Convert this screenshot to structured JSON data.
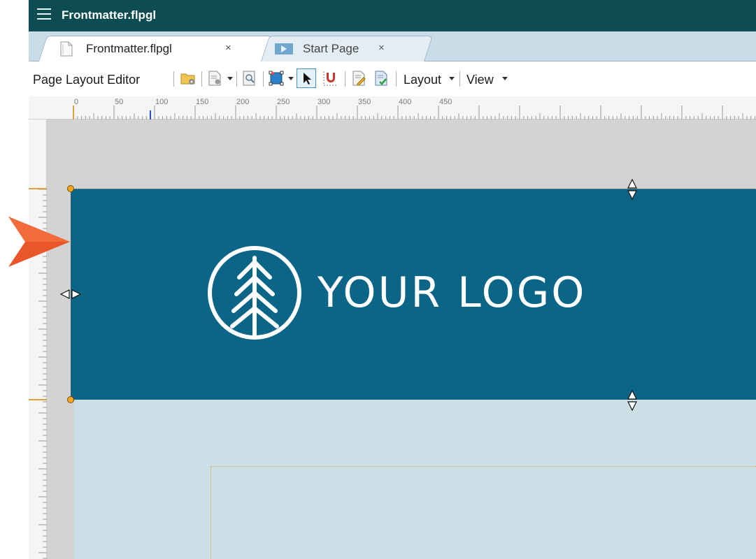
{
  "window": {
    "title": "Frontmatter.flpgl"
  },
  "tabs": [
    {
      "label": "Frontmatter.flpgl",
      "close": "×",
      "active": true
    },
    {
      "label": "Start Page",
      "close": "×",
      "active": false
    }
  ],
  "toolbar": {
    "editor_label": "Page Layout Editor",
    "layout_menu": "Layout",
    "view_menu": "View",
    "icons": [
      "open-folder-icon",
      "page-properties-icon",
      "zoom-icon",
      "frame-tool-icon",
      "pointer-icon",
      "snap-magnet-icon",
      "edit-page-icon",
      "check-page-icon"
    ]
  },
  "ruler": {
    "labels": [
      "0",
      "50",
      "100",
      "150",
      "200",
      "250",
      "300",
      "350",
      "400",
      "450"
    ]
  },
  "banner": {
    "logo_text": "YOUR LOGO",
    "background_color": "#0a6587"
  },
  "colors": {
    "title_bar": "#0c4c52",
    "tab_strip": "#c9dde9",
    "canvas": "#d3d3d3",
    "page_area": "#ccdfe7",
    "handle": "#f5a623",
    "callout_arrow": "#e8562a"
  }
}
